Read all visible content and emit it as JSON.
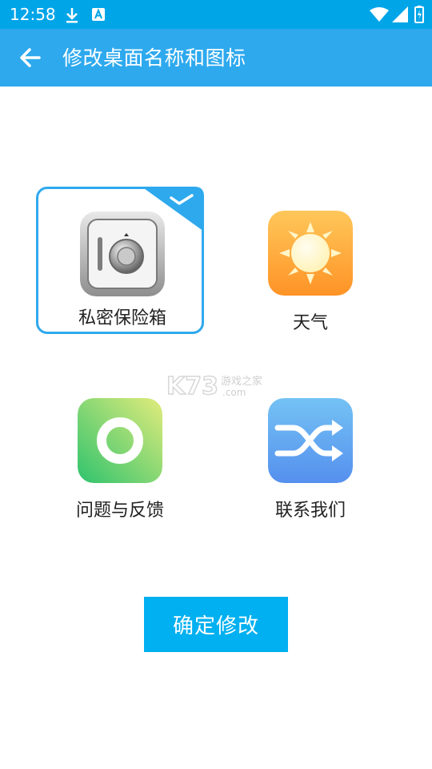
{
  "status_bar": {
    "time": "12:58",
    "icons": [
      "download-icon",
      "app-notification-icon",
      "wifi-icon",
      "signal-icon",
      "battery-icon"
    ]
  },
  "app_bar": {
    "title": "修改桌面名称和图标",
    "back_icon": "arrow-left-icon"
  },
  "options": [
    {
      "label": "私密保险箱",
      "icon": "safe-icon",
      "selected": true
    },
    {
      "label": "天气",
      "icon": "sun-icon",
      "selected": false
    },
    {
      "label": "问题与反馈",
      "icon": "ring-icon",
      "selected": false
    },
    {
      "label": "联系我们",
      "icon": "shuffle-icon",
      "selected": false
    }
  ],
  "watermark": {
    "text": "K73",
    "subtext": "游戏之家",
    "domain": ".com"
  },
  "confirm_button": {
    "label": "确定修改"
  },
  "colors": {
    "status_bar": "#00a5e8",
    "app_bar": "#2ea9ee",
    "selection": "#2ea9ee",
    "button": "#00b0f0"
  }
}
